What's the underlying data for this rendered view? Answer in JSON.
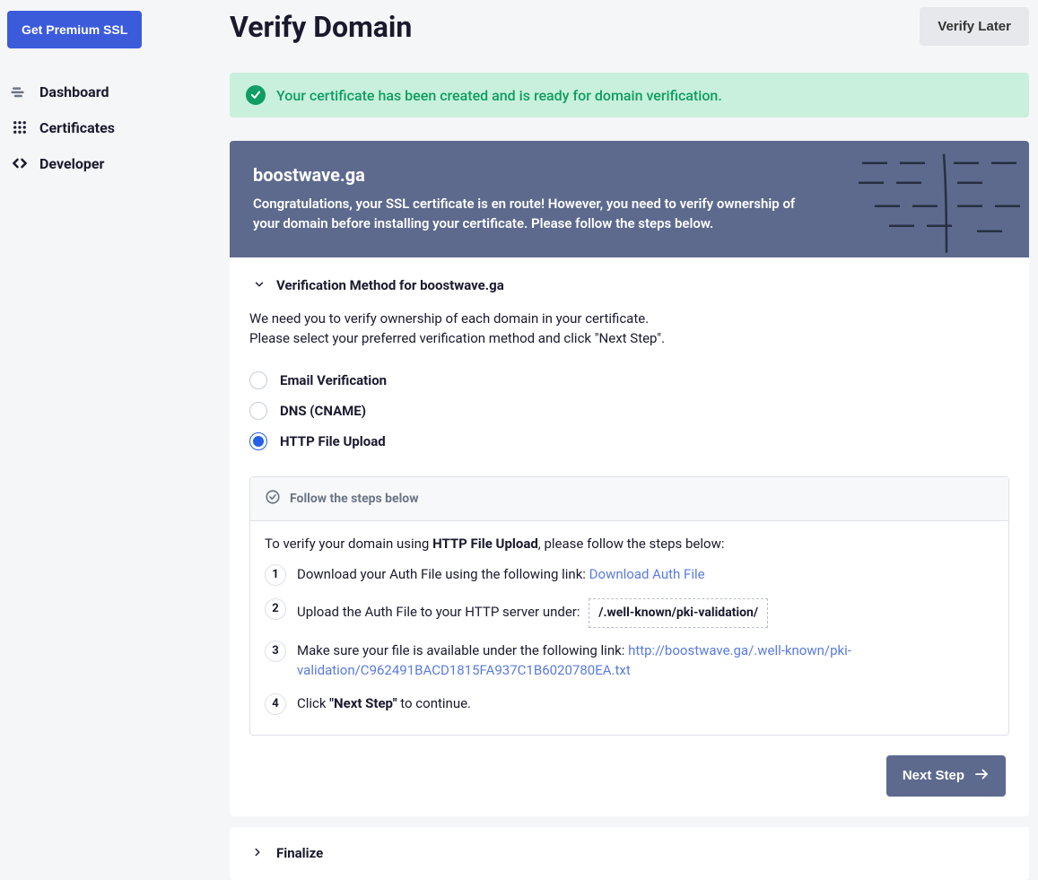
{
  "sidebar": {
    "premium_label": "Get Premium SSL",
    "items": [
      {
        "label": "Dashboard",
        "icon": "dashboard"
      },
      {
        "label": "Certificates",
        "icon": "grid"
      },
      {
        "label": "Developer",
        "icon": "code"
      }
    ]
  },
  "header": {
    "title": "Verify Domain",
    "verify_later_label": "Verify Later"
  },
  "alert": {
    "text": "Your certificate has been created and is ready for domain verification."
  },
  "domain_card": {
    "domain": "boostwave.ga",
    "subtitle": "Congratulations, your SSL certificate is en route! However, you need to verify ownership of your domain before installing your certificate. Please follow the steps below."
  },
  "verification": {
    "title": "Verification Method for boostwave.ga",
    "intro_line1": "We need you to verify ownership of each domain in your certificate.",
    "intro_line2": "Please select your preferred verification method and click \"Next Step\".",
    "methods": [
      {
        "label": "Email Verification",
        "selected": false
      },
      {
        "label": "DNS (CNAME)",
        "selected": false
      },
      {
        "label": "HTTP File Upload",
        "selected": true
      }
    ],
    "steps_header": "Follow the steps below",
    "steps_intro_prefix": "To verify your domain using ",
    "steps_intro_method": "HTTP File Upload",
    "steps_intro_suffix": ", please follow the steps below:",
    "step1_text": "Download your Auth File using the following link: ",
    "step1_link": "Download Auth File",
    "step2_text": "Upload the Auth File to your HTTP server under:",
    "step2_path": "/.well-known/pki-validation/",
    "step3_text": "Make sure your file is available under the following link: ",
    "step3_link": "http://boostwave.ga/.well-known/pki-validation/C962491BACD1815FA937C1B6020780EA.txt",
    "step4_prefix": "Click ",
    "step4_bold": "\"Next Step\"",
    "step4_suffix": " to continue.",
    "next_step_label": "Next Step"
  },
  "finalize": {
    "title": "Finalize"
  }
}
